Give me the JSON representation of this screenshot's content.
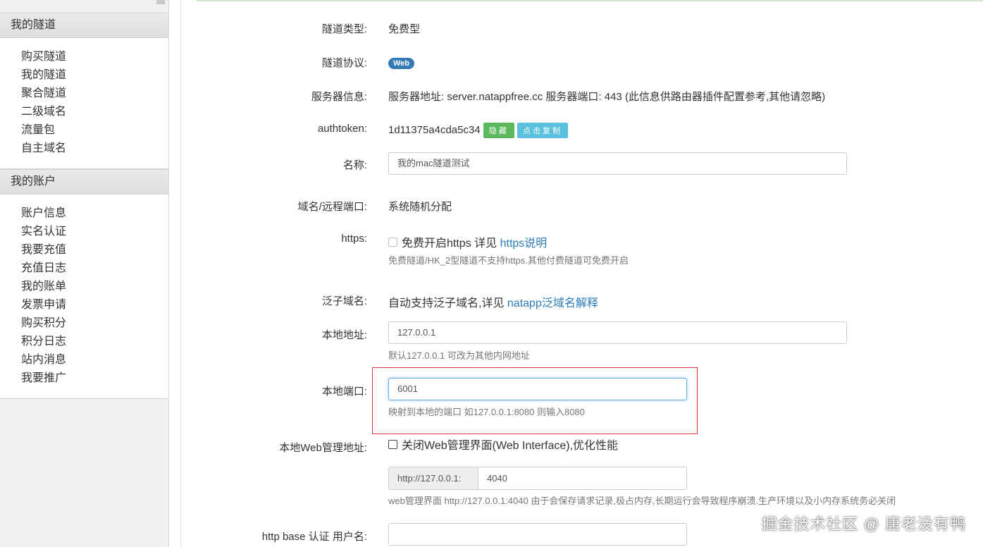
{
  "sidebar": {
    "section1": {
      "title": "我的隧道",
      "items": [
        "购买隧道",
        "我的隧道",
        "聚合隧道",
        "二级域名",
        "流量包",
        "自主域名"
      ]
    },
    "section2": {
      "title": "我的账户",
      "items": [
        "账户信息",
        "实名认证",
        "我要充值",
        "充值日志",
        "我的账单",
        "发票申请",
        "购买积分",
        "积分日志",
        "站内消息",
        "我要推广"
      ]
    }
  },
  "form": {
    "tunnel_type": {
      "label": "隧道类型:",
      "value": "免费型"
    },
    "protocol": {
      "label": "隧道协议:",
      "badge": "Web"
    },
    "server_info": {
      "label": "服务器信息:",
      "value": "服务器地址: server.natappfree.cc 服务器端口: 443 (此信息供路由器插件配置参考,其他请忽略)"
    },
    "authtoken": {
      "label": "authtoken:",
      "value": "1d11375a4cda5c34",
      "hide_button": "隐藏",
      "copy_button": "点击复制"
    },
    "name": {
      "label": "名称:",
      "value": "我的mac隧道测试"
    },
    "domain_port": {
      "label": "域名/远程端口:",
      "value": "系统随机分配"
    },
    "https": {
      "label": "https:",
      "checkbox_text": "免费开启https 详见",
      "link": "https说明",
      "help": "免费隧道/HK_2型隧道不支持https.其他付费隧道可免费开启"
    },
    "wildcard": {
      "label": "泛子域名:",
      "text": "自动支持泛子域名,详见",
      "link": "natapp泛域名解释"
    },
    "local_addr": {
      "label": "本地地址:",
      "value": "127.0.0.1",
      "help": "默认127.0.0.1 可改为其他内网地址"
    },
    "local_port": {
      "label": "本地端口:",
      "value": "6001",
      "help": "映射到本地的端口 如127.0.0.1:8080 则输入8080"
    },
    "web_admin": {
      "label": "本地Web管理地址:",
      "checkbox_text": "关闭Web管理界面(Web Interface),优化性能",
      "addon": "http://127.0.0.1:",
      "port": "4040",
      "help": "web管理界面 http://127.0.0.1:4040 由于会保存请求记录,极占内存,长期运行会导致程序崩溃.生产环境以及小内存系统务必关闭"
    },
    "http_auth": {
      "label": "http base 认证 用户名:",
      "value": ""
    }
  },
  "watermark": "掘金技术社区 @ 唐老没有鸭",
  "colors": {
    "link": "#2a7ab8",
    "badge": "#337ab7",
    "green": "#5cb85c",
    "cyan": "#5bc0de",
    "highlight": "#d9363e"
  }
}
